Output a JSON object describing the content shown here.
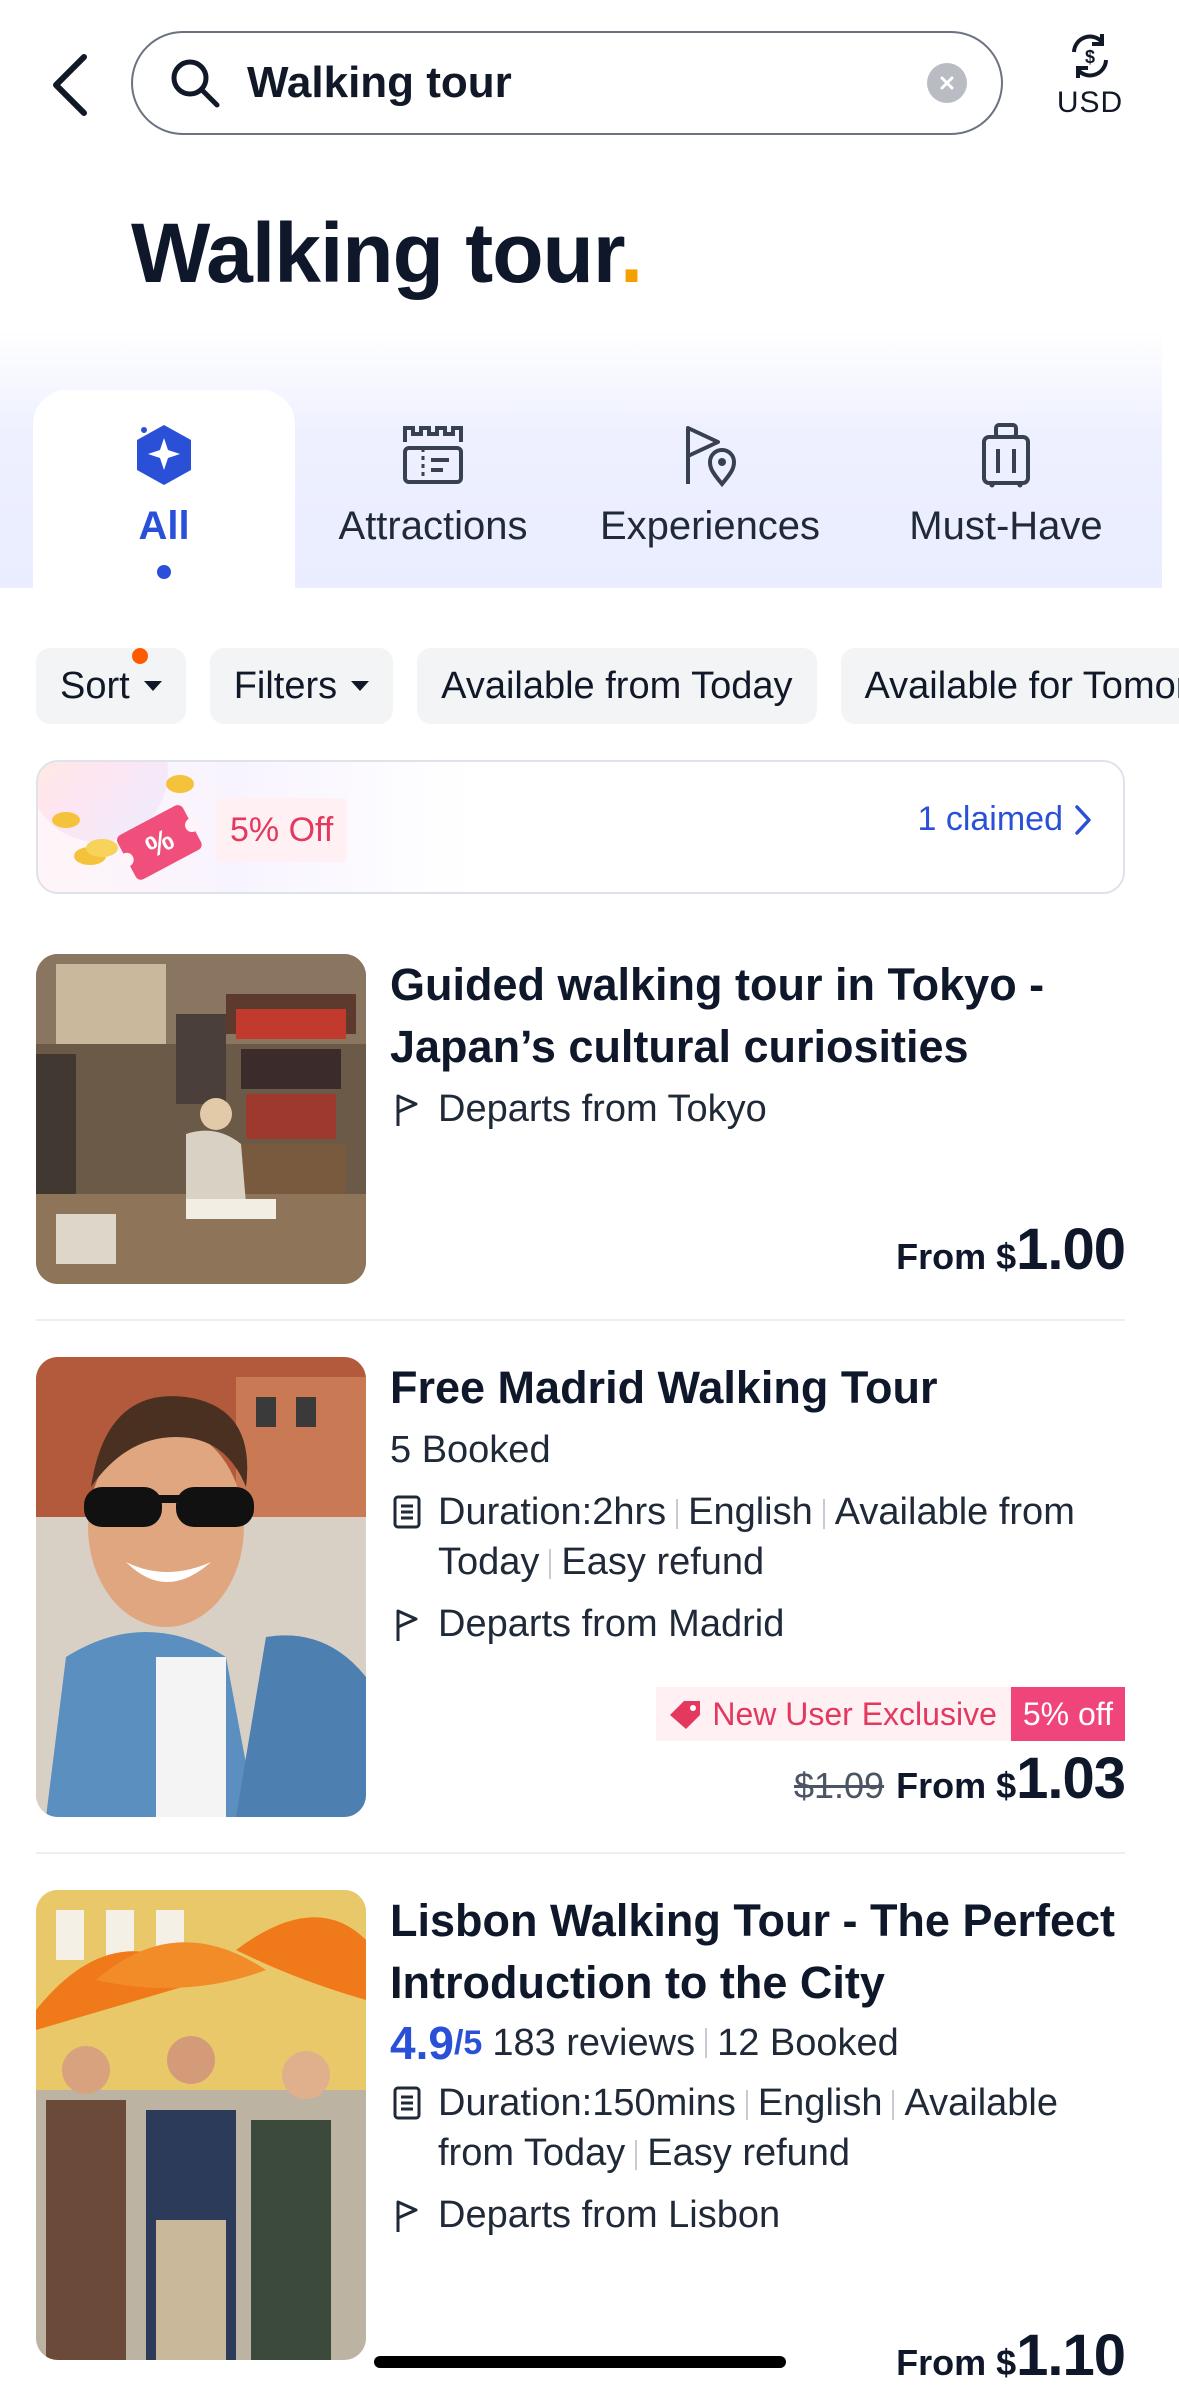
{
  "search": {
    "query": "Walking tour",
    "currency_label": "USD"
  },
  "page": {
    "title": "Walking tour",
    "title_dot": "."
  },
  "tabs": [
    {
      "label": "All",
      "icon": "sparkle-badge-icon",
      "active": true
    },
    {
      "label": "Attractions",
      "icon": "castle-ticket-icon"
    },
    {
      "label": "Experiences",
      "icon": "flag-pin-icon"
    },
    {
      "label": "Must-Have",
      "icon": "luggage-icon"
    }
  ],
  "filters": {
    "sort_label": "Sort",
    "filters_label": "Filters",
    "chip_today": "Available from Today",
    "chip_tomorrow": "Available for Tomorrow"
  },
  "promo": {
    "discount": "5% Off",
    "claimed": "1 claimed"
  },
  "products": [
    {
      "title": "Guided walking tour in Tokyo - Japan’s cultural curiosities",
      "departs": "Departs from Tokyo",
      "from_label": "From $",
      "price": "1.00"
    },
    {
      "title": "Free Madrid Walking Tour",
      "booked": "5 Booked",
      "duration": "Duration:2hrs",
      "language": "English",
      "availability_a": "Available from",
      "availability_b": "Today",
      "refund": "Easy refund",
      "departs": "Departs from Madrid",
      "badge_label": "New User Exclusive",
      "badge_discount": "5% off",
      "original_price": "$1.09",
      "from_label": "From $",
      "price": "1.03"
    },
    {
      "title": "Lisbon Walking Tour - The Perfect Introduction to the City",
      "rating": "4.9",
      "rating_of": "/5",
      "reviews": "183 reviews",
      "booked": "12 Booked",
      "duration": "Duration:150mins",
      "language": "English",
      "availability_a": "Available",
      "availability_b": "from Today",
      "refund": "Easy refund",
      "departs": "Departs from Lisbon",
      "from_label": "From $",
      "price": "1.10"
    }
  ],
  "colors": {
    "accent": "#2b50d8",
    "promo_pink": "#e4385f",
    "title_dot": "#f5a000"
  }
}
